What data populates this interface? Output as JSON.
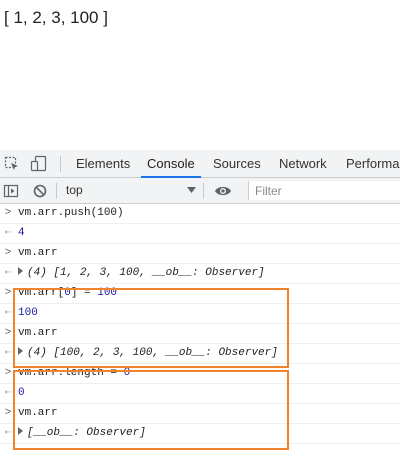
{
  "page": {
    "output_text": "[ 1, 2, 3, 100 ]"
  },
  "devtools": {
    "tabs": [
      "Elements",
      "Console",
      "Sources",
      "Network",
      "Performan"
    ],
    "active_tab": "Console",
    "icons": [
      "inspect-element-icon",
      "device-toolbar-icon",
      "show-sidebar-icon",
      "clear-console-icon",
      "dropdown-arrow-icon",
      "eye-icon"
    ],
    "context_select": "top",
    "filter_placeholder": "Filter"
  },
  "console": {
    "entries": [
      {
        "kind": "input",
        "text": "vm.arr.push(100)"
      },
      {
        "kind": "result",
        "text": "4"
      },
      {
        "kind": "input",
        "text": "vm.arr"
      },
      {
        "kind": "result-object",
        "count": "(4)",
        "text": "[1, 2, 3, 100, __ob__: Observer]"
      },
      {
        "kind": "input",
        "parts": [
          "vm.arr[",
          "0",
          "] = ",
          "100"
        ]
      },
      {
        "kind": "result",
        "text": "100"
      },
      {
        "kind": "input",
        "text": "vm.arr"
      },
      {
        "kind": "result-object",
        "count": "(4)",
        "text": "[100, 2, 3, 100, __ob__: Observer]"
      },
      {
        "kind": "input",
        "parts": [
          "vm.arr.length = ",
          "0"
        ]
      },
      {
        "kind": "result",
        "text": "0"
      },
      {
        "kind": "input",
        "text": "vm.arr"
      },
      {
        "kind": "result-object",
        "count": "",
        "text": "[__ob__: Observer]"
      }
    ]
  },
  "colors": {
    "highlight_border": "#f0832b",
    "active_tab_indicator": "#1a73e8",
    "number": "#1a1aa6"
  }
}
